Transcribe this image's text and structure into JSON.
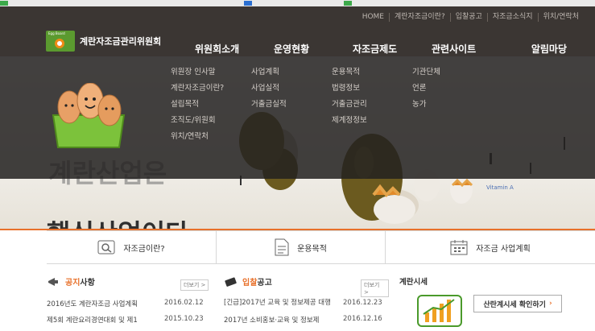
{
  "utility_nav": [
    "HOME",
    "계란자조금이란?",
    "입찰공고",
    "자조금소식지",
    "위치/연락처"
  ],
  "brand": {
    "name": "계란자조금관리위원회",
    "tag": "Egg Board",
    "accent": "#e8702a",
    "green": "#5b9a2f"
  },
  "gnb": [
    "위원회소개",
    "운영현황",
    "자조금제도",
    "관련사이트",
    "알림마당"
  ],
  "mega_menu": {
    "col1": [
      "위원장 인사말",
      "계란자조금이란?",
      "설립목적",
      "조직도/위원회",
      "위치/연락처"
    ],
    "col2": [
      "사업계획",
      "사업실적",
      "거출금실적"
    ],
    "col3": [
      "운용목적",
      "법령정보",
      "거출금관리",
      "제계정정보"
    ],
    "col4": [
      "기관단체",
      "언론",
      "농가"
    ]
  },
  "hero": {
    "slogan_line1": "계란산업은",
    "slogan_line2": "핵심산업이다",
    "vitamin_label": "Vitamin A"
  },
  "quick_links": [
    "자조금이란?",
    "운용목적",
    "자조금 사업계획"
  ],
  "notice": {
    "title_highlight": "공지",
    "title_rest": "사항",
    "more": "더보기 >",
    "items": [
      {
        "title": "2016년도 계란자조금 사업계획",
        "date": "2016.02.12"
      },
      {
        "title": "제5회 계란요리경연대회 및 제1",
        "date": "2015.10.23"
      }
    ]
  },
  "bid": {
    "title_highlight": "입찰",
    "title_rest": "공고",
    "more": "더보기 >",
    "items": [
      {
        "title": "[긴급]2017년 교육 및 정보제공 대행",
        "date": "2016.12.23"
      },
      {
        "title": "2017년 소비홍보·교육 및 정보제",
        "date": "2016.12.16"
      }
    ]
  },
  "market": {
    "title": "계란시세",
    "button": "산란계시세 확인하기"
  }
}
